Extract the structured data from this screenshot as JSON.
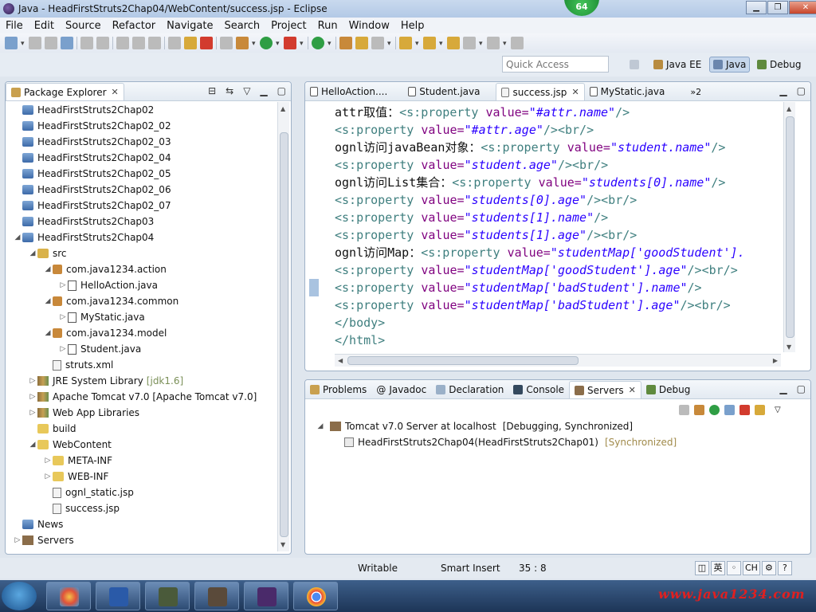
{
  "window": {
    "title": "Java - HeadFirstStruts2Chap04/WebContent/success.jsp - Eclipse",
    "badge": "64"
  },
  "menu": [
    "File",
    "Edit",
    "Source",
    "Refactor",
    "Navigate",
    "Search",
    "Project",
    "Run",
    "Window",
    "Help"
  ],
  "perspective": {
    "quick_access_placeholder": "Quick Access",
    "buttons": [
      "Java EE",
      "Java",
      "Debug"
    ]
  },
  "package_explorer": {
    "tab_label": "Package Explorer",
    "items": [
      {
        "label": "HeadFirstStruts2Chap02",
        "icon": "project-icon"
      },
      {
        "label": "HeadFirstStruts2Chap02_02",
        "icon": "project-icon"
      },
      {
        "label": "HeadFirstStruts2Chap02_03",
        "icon": "project-icon"
      },
      {
        "label": "HeadFirstStruts2Chap02_04",
        "icon": "project-icon"
      },
      {
        "label": "HeadFirstStruts2Chap02_05",
        "icon": "project-icon"
      },
      {
        "label": "HeadFirstStruts2Chap02_06",
        "icon": "project-icon"
      },
      {
        "label": "HeadFirstStruts2Chap02_07",
        "icon": "project-icon"
      },
      {
        "label": "HeadFirstStruts2Chap03",
        "icon": "project-icon"
      },
      {
        "label": "HeadFirstStruts2Chap04",
        "icon": "project-icon"
      },
      {
        "label": "src",
        "icon": "source-folder-icon"
      },
      {
        "label": "com.java1234.action",
        "icon": "package-icon"
      },
      {
        "label": "HelloAction.java",
        "icon": "java-file-icon"
      },
      {
        "label": "com.java1234.common",
        "icon": "package-icon"
      },
      {
        "label": "MyStatic.java",
        "icon": "java-file-icon"
      },
      {
        "label": "com.java1234.model",
        "icon": "package-icon"
      },
      {
        "label": "Student.java",
        "icon": "java-file-icon"
      },
      {
        "label": "struts.xml",
        "icon": "xml-file-icon"
      },
      {
        "label": "JRE System Library",
        "decoration": "[jdk1.6]",
        "icon": "library-icon"
      },
      {
        "label": "Apache Tomcat v7.0 [Apache Tomcat v7.0]",
        "icon": "library-icon"
      },
      {
        "label": "Web App Libraries",
        "icon": "library-icon"
      },
      {
        "label": "build",
        "icon": "folder-icon"
      },
      {
        "label": "WebContent",
        "icon": "folder-icon"
      },
      {
        "label": "META-INF",
        "icon": "folder-icon"
      },
      {
        "label": "WEB-INF",
        "icon": "folder-icon"
      },
      {
        "label": "ognl_static.jsp",
        "icon": "jsp-file-icon"
      },
      {
        "label": "success.jsp",
        "icon": "jsp-file-icon"
      },
      {
        "label": "News",
        "icon": "project-icon"
      },
      {
        "label": "Servers",
        "icon": "servers-folder-icon"
      }
    ]
  },
  "editor": {
    "tabs": [
      "HelloAction....",
      "Student.java",
      "success.jsp",
      "MyStatic.java"
    ],
    "overflow_count": "»2",
    "lines": [
      {
        "prefix": "attr取值：",
        "tag": "<s:property ",
        "attr": "value=",
        "val": "\"#attr.name\"",
        "tail": "/>"
      },
      {
        "prefix": "",
        "tag": "<s:property ",
        "attr": "value=",
        "val": "\"#attr.age\"",
        "tail": "/><br/>"
      },
      {
        "prefix": "ognl访问javaBean对象：",
        "tag": "<s:property ",
        "attr": "value=",
        "val": "\"student.name\"",
        "tail": "/>"
      },
      {
        "prefix": "",
        "tag": "<s:property ",
        "attr": "value=",
        "val": "\"student.age\"",
        "tail": "/><br/>"
      },
      {
        "prefix": "ognl访问List集合：",
        "tag": "<s:property ",
        "attr": "value=",
        "val": "\"students[0].name\"",
        "tail": "/>"
      },
      {
        "prefix": "",
        "tag": "<s:property ",
        "attr": "value=",
        "val": "\"students[0].age\"",
        "tail": "/><br/>"
      },
      {
        "prefix": "",
        "tag": "<s:property ",
        "attr": "value=",
        "val": "\"students[1].name\"",
        "tail": "/>"
      },
      {
        "prefix": "",
        "tag": "<s:property ",
        "attr": "value=",
        "val": "\"students[1].age\"",
        "tail": "/><br/>"
      },
      {
        "prefix": "ognl访问Map：",
        "tag": "<s:property ",
        "attr": "value=",
        "val": "\"studentMap['goodStudent'].",
        "tail": ""
      },
      {
        "prefix": "",
        "tag": "<s:property ",
        "attr": "value=",
        "val": "\"studentMap['goodStudent'].age\"",
        "tail": "/><br/>"
      },
      {
        "prefix": "",
        "tag": "<s:property ",
        "attr": "value=",
        "val": "\"studentMap['badStudent'].name\"",
        "tail": "/>"
      },
      {
        "prefix": "",
        "tag": "<s:property ",
        "attr": "value=",
        "val": "\"studentMap['badStudent'].age\"",
        "tail": "/><br/>"
      },
      {
        "prefix": "",
        "tag": "</body>",
        "attr": "",
        "val": "",
        "tail": ""
      },
      {
        "prefix": "",
        "tag": "</html>",
        "attr": "",
        "val": "",
        "tail": ""
      }
    ]
  },
  "bottom_panel": {
    "tabs": [
      "Problems",
      "Javadoc",
      "Declaration",
      "Console",
      "Servers",
      "Debug"
    ],
    "server": {
      "name": "Tomcat v7.0 Server at localhost",
      "state": "[Debugging, Synchronized]",
      "module": "HeadFirstStruts2Chap04(HeadFirstStruts2Chap01)",
      "module_state": "[Synchronized]"
    }
  },
  "statusbar": {
    "writable": "Writable",
    "insert_mode": "Smart Insert",
    "position": "35 : 8",
    "ime": [
      "英",
      "CH"
    ]
  },
  "taskbar": {
    "watermark": "www.java1234.com"
  }
}
